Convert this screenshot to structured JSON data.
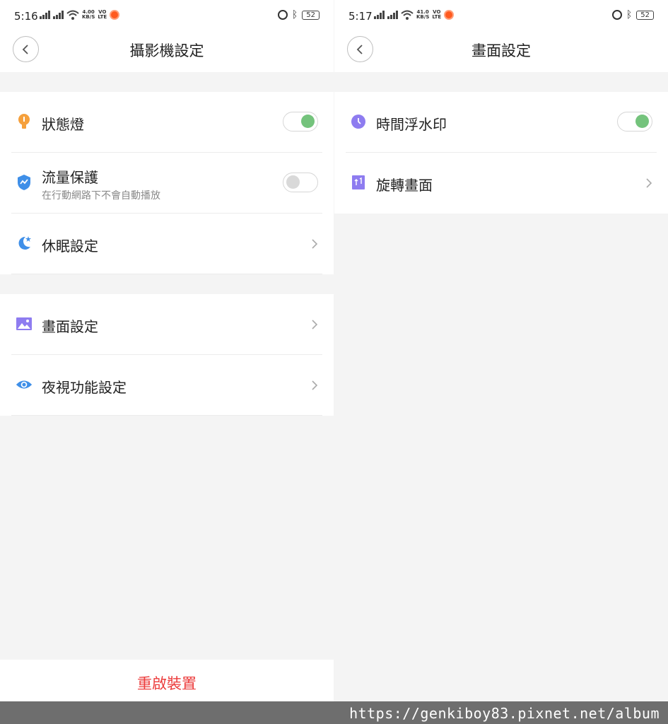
{
  "colors": {
    "toggle_on": "#74c37c",
    "danger": "#ec3b3b",
    "icon_orange": "#f5a03c",
    "icon_blue": "#3f8fe8",
    "icon_purple": "#8e7cf0"
  },
  "left_screen": {
    "status": {
      "time": "5:16",
      "net_speed_top": "4.00",
      "net_speed_unit": "KB/S",
      "volte_top": "VO",
      "volte_bottom": "LTE",
      "battery": "52"
    },
    "header": {
      "title": "攝影機設定"
    },
    "group1": [
      {
        "label": "狀態燈",
        "icon": "lightbulb-icon",
        "control": "toggle",
        "toggle_on": true
      },
      {
        "label": "流量保護",
        "subtitle": "在行動網路下不會自動播放",
        "icon": "shield-icon",
        "control": "toggle",
        "toggle_on": false
      },
      {
        "label": "休眠設定",
        "icon": "moon-icon",
        "control": "chevron"
      }
    ],
    "group2": [
      {
        "label": "畫面設定",
        "icon": "image-icon",
        "control": "chevron"
      },
      {
        "label": "夜視功能設定",
        "icon": "eye-icon",
        "control": "chevron"
      }
    ],
    "reboot_label": "重啟裝置"
  },
  "right_screen": {
    "status": {
      "time": "5:17",
      "net_speed_top": "41.0",
      "net_speed_unit": "KB/S",
      "volte_top": "VO",
      "volte_bottom": "LTE",
      "battery": "52"
    },
    "header": {
      "title": "畫面設定"
    },
    "group1": [
      {
        "label": "時間浮水印",
        "icon": "clock-icon",
        "control": "toggle",
        "toggle_on": true
      },
      {
        "label": "旋轉畫面",
        "icon": "rotate-icon",
        "control": "chevron"
      }
    ]
  },
  "watermark": "https://genkiboy83.pixnet.net/album"
}
